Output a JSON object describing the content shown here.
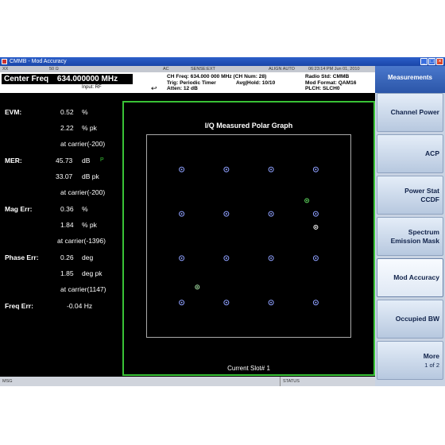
{
  "window": {
    "title": "CMMB - Mod Accuracy"
  },
  "status_strip": {
    "mode": "XX",
    "impedance": "50 Ω",
    "coupling": "AC",
    "sense": "SENSE:EXT",
    "align": "ALIGN AUTO",
    "datetime": "06:23:14 PM Jun 01, 2010"
  },
  "header": {
    "center_freq_label": "Center Freq",
    "center_freq_value": "634.000000 MHz",
    "input": "Input: RF",
    "ch_freq": "CH Freq: 634.000 000 MHz (CH Num: 28)",
    "trig": "Trig: Periodic Timer",
    "avg_hold": "Avg|Hold: 10/10",
    "atten": "Atten: 12 dB",
    "radio_std": "Radio Std: CMMB",
    "mod_format": "Mod Format: QAM16",
    "plch": "PLCH: SLCH0"
  },
  "results": {
    "evm": {
      "label": "EVM:",
      "value": "0.52",
      "unit": "%",
      "pk_value": "2.22",
      "pk_unit": "% pk",
      "carrier": "at carrier(-200)"
    },
    "mer": {
      "label": "MER:",
      "value": "45.73",
      "unit": "dB",
      "flag": "P",
      "pk_value": "33.07",
      "pk_unit": "dB pk",
      "carrier": "at carrier(-200)"
    },
    "mag_err": {
      "label": "Mag Err:",
      "value": "0.36",
      "unit": "%",
      "pk_value": "1.84",
      "pk_unit": "% pk",
      "carrier": "at carrier(-1396)"
    },
    "phase_err": {
      "label": "Phase Err:",
      "value": "0.26",
      "unit": "deg",
      "pk_value": "1.85",
      "pk_unit": "deg pk",
      "carrier": "at carrier(1147)"
    },
    "freq_err": {
      "label": "Freq Err:",
      "value": "-0.04 Hz"
    }
  },
  "graph": {
    "title": "I/Q Measured Polar Graph",
    "footer": "Current Slot# 1",
    "constellation": {
      "grid": [
        -3,
        -1,
        1,
        3
      ],
      "highlights": [
        {
          "i": 2.6,
          "q": 1.6,
          "color": "#5fd95f"
        },
        {
          "i": 3.0,
          "q": 0.4,
          "color": "#ffffff"
        },
        {
          "i": -2.3,
          "q": -2.3,
          "color": "#a8e5a8"
        }
      ],
      "point_color": "#8ea0ff",
      "axis_range": [
        -4.55,
        4.55
      ]
    }
  },
  "softkeys": {
    "title": "Measurements",
    "items": [
      {
        "label": "Channel Power",
        "sub": ""
      },
      {
        "label": "ACP",
        "sub": ""
      },
      {
        "label": "Power Stat",
        "sub": "CCDF"
      },
      {
        "label": "Spectrum",
        "sub": "Emission Mask"
      },
      {
        "label": "Mod Accuracy",
        "sub": ""
      },
      {
        "label": "Occupied BW",
        "sub": ""
      },
      {
        "label": "More",
        "sub": "1 of 2"
      }
    ]
  },
  "bottom": {
    "msg": "MSG",
    "status": "STATUS"
  },
  "colors": {
    "graph_border": "#39c236",
    "title_bar": "#2c5fc9",
    "softkey_text": "#10224a"
  }
}
